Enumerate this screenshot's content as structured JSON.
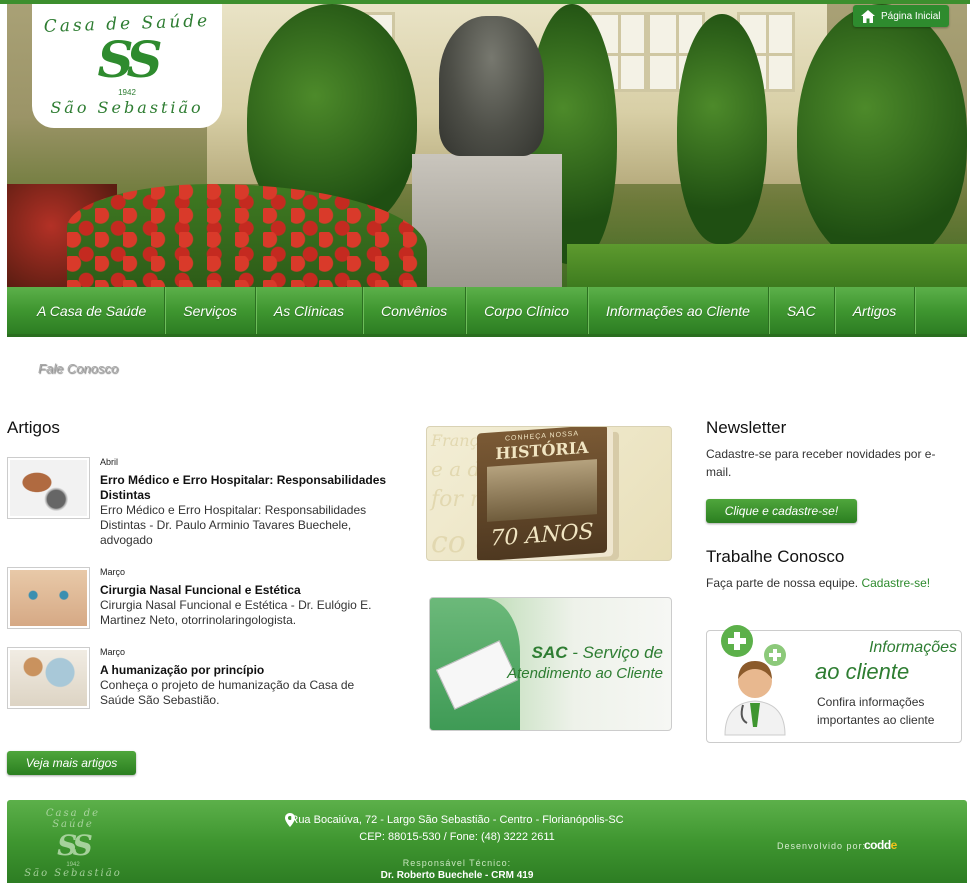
{
  "header": {
    "logo_top": "Casa de Saúde",
    "logo_monogram": "SS",
    "logo_year": "1942",
    "logo_bottom": "São Sebastião",
    "home_label": "Página Inicial"
  },
  "nav": {
    "items": [
      "A Casa de Saúde",
      "Serviços",
      "As Clínicas",
      "Convênios",
      "Corpo Clínico",
      "Informações ao Cliente",
      "SAC",
      "Artigos"
    ],
    "sub": "Fale Conosco"
  },
  "artigos": {
    "heading": "Artigos",
    "items": [
      {
        "month": "Abril",
        "title": "Erro Médico e Erro Hospitalar: Responsabilidades Distintas",
        "desc": "Erro Médico e Erro Hospitalar: Responsabilidades Distintas - Dr. Paulo Arminio Tavares Buechele, advogado",
        "thumb_icon": "stethoscope-gavel-icon"
      },
      {
        "month": "Março",
        "title": "Cirurgia Nasal Funcional e Estética",
        "desc": "Cirurgia Nasal Funcional e Estética - Dr. Eulógio E. Martinez Neto, otorrinolaringologista.",
        "thumb_icon": "face-icon"
      },
      {
        "month": "Março",
        "title": "A humanização por princípio",
        "desc": "Conheça o projeto de humanização da Casa de Saúde São Sebastião.",
        "thumb_icon": "care-icon"
      }
    ],
    "more_label": "Veja mais artigos"
  },
  "banners": {
    "historia_top": "CONHEÇA NOSSA",
    "historia_title": "HISTÓRIA",
    "historia_years": "70 ANOS",
    "sac_bold": "SAC",
    "sac_line1": " - Serviço de",
    "sac_line2": "Atendimento ao Cliente"
  },
  "newsletter": {
    "heading": "Newsletter",
    "text": "Cadastre-se para receber novidades por e-mail.",
    "button": "Clique e cadastre-se!"
  },
  "trabalhe": {
    "heading": "Trabalhe Conosco",
    "text": "Faça parte de nossa equipe. ",
    "link": "Cadastre-se!"
  },
  "info_cliente": {
    "title1": "Informações",
    "title2": "ao cliente",
    "text": "Confira informações importantes ao cliente"
  },
  "footer": {
    "address": "Rua Bocaiúva, 72 - Largo São Sebastião - Centro - Florianópolis-SC",
    "cep": "CEP: 88015-530 / Fone: (48) 3222 2611",
    "resp_label": "Responsável Técnico:",
    "resp_name": "Dr. Roberto Buechele - CRM 419",
    "dev_label": "Desenvolvido por:",
    "dev_logo_a": "codd",
    "dev_logo_b": "e"
  },
  "colors": {
    "brand_green": "#2e8b2e",
    "nav_green": "#3f9630"
  }
}
